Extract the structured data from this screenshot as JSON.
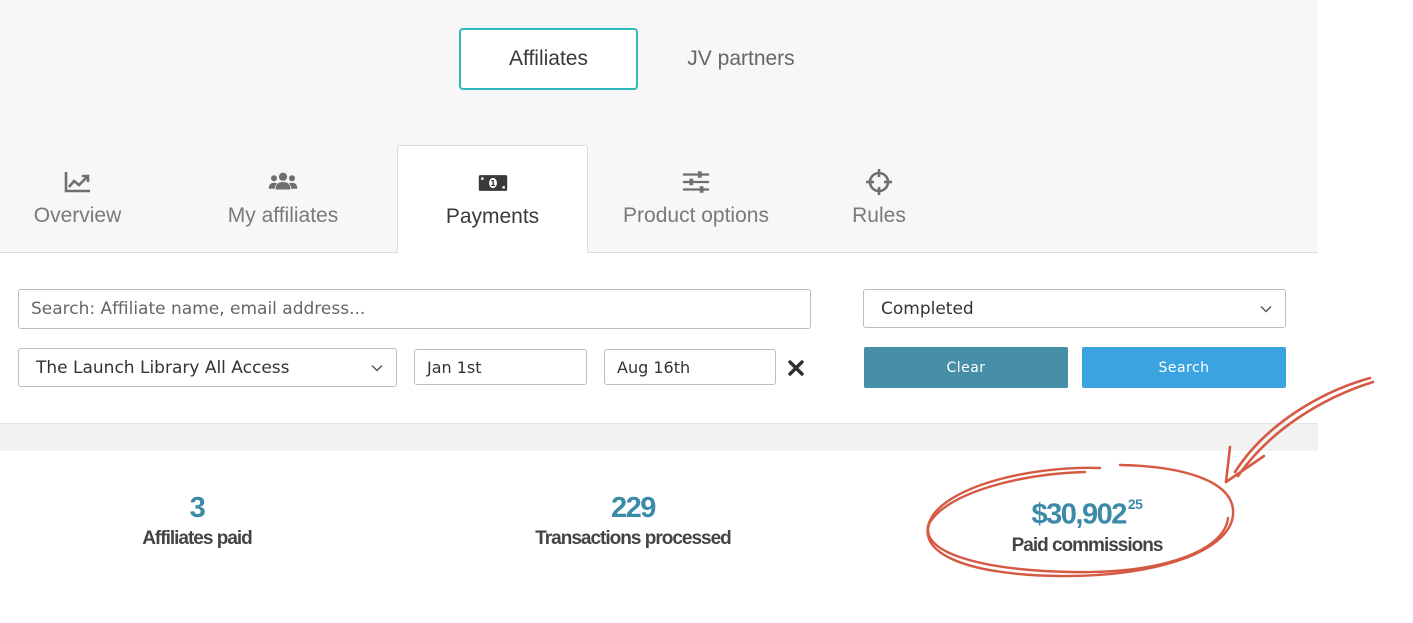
{
  "toggle": {
    "active_label": "Affiliates",
    "inactive_label": "JV partners"
  },
  "tabs": [
    {
      "label": "Overview",
      "icon": "chart-line-icon"
    },
    {
      "label": "My affiliates",
      "icon": "users-icon"
    },
    {
      "label": "Payments",
      "icon": "money-bill-icon"
    },
    {
      "label": "Product options",
      "icon": "sliders-icon"
    },
    {
      "label": "Rules",
      "icon": "crosshair-icon"
    }
  ],
  "filters": {
    "search_placeholder": "Search: Affiliate name, email address...",
    "status_selected": "Completed",
    "product_selected": "The Launch Library All Access",
    "date_from": "Jan 1st",
    "date_to": "Aug 16th",
    "clear_label": "Clear",
    "search_label": "Search"
  },
  "stats": [
    {
      "value": "3",
      "label": "Affiliates paid"
    },
    {
      "value": "229",
      "label": "Transactions processed"
    },
    {
      "value": "$30,902",
      "cents": "25",
      "label": "Paid commissions"
    }
  ],
  "colors": {
    "accent_teal": "#2fb8bd",
    "clear_button": "#468fa7",
    "search_button": "#3ba4e0",
    "stat_value": "#3a8aa8",
    "annotation_red": "#d65a43"
  }
}
